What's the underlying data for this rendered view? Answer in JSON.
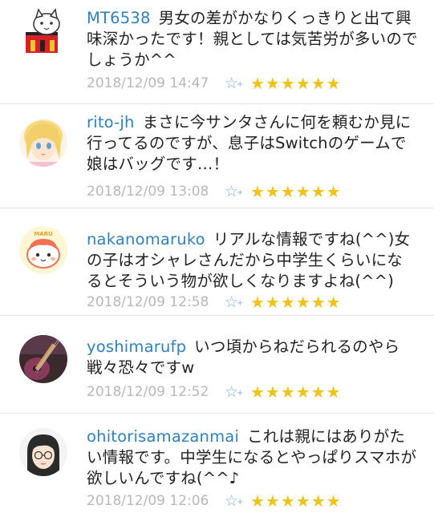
{
  "comments": [
    {
      "username": "MT6538",
      "text": "男女の差がかなりくっきりと出て興味深かったです！親としては気苦労が多いのでしょうか^^",
      "date": "2018/12/09 14:47",
      "add_star_icon": "☆",
      "stars": "★★★★★★",
      "avatar_icon": "cat-box-avatar"
    },
    {
      "username": "rito-jh",
      "text": "まさに今サンタさんに何を頼むか見に行ってるのですが、息子はSwitchのゲームで娘はバッグです…！",
      "date": "2018/12/09 13:08",
      "add_star_icon": "☆",
      "stars": "★★★★★★",
      "avatar_icon": "anime-girl-avatar"
    },
    {
      "username": "nakanomaruko",
      "text": "リアルな情報ですね(^^)女の子はオシャレさんだから中学生くらいになるとそういう物が欲しくなりますよね(^^)",
      "date": "2018/12/09 12:58",
      "add_star_icon": "☆",
      "stars": "★★★★★★",
      "avatar_icon": "maru-character-avatar",
      "avatar_text": "MARU"
    },
    {
      "username": "yoshimarufp",
      "text": "いつ頃からねだられるのやら戦々恐々ですw",
      "date": "2018/12/09 12:52",
      "add_star_icon": "☆",
      "stars": "★★★★★★",
      "avatar_icon": "guitar-avatar"
    },
    {
      "username": "ohitorisamazanmai",
      "text": "これは親にはありがたい情報です。中学生になるとやっぱりスマホが欲しいんですね(^^♪",
      "date": "2018/12/09 12:06",
      "add_star_icon": "☆",
      "stars": "★★★★★★",
      "avatar_icon": "glasses-woman-avatar"
    }
  ],
  "colors": {
    "username": "#2f80bf",
    "date": "#b8b8b8",
    "star": "#f0c21a",
    "add_star": "#7fb3dd"
  }
}
